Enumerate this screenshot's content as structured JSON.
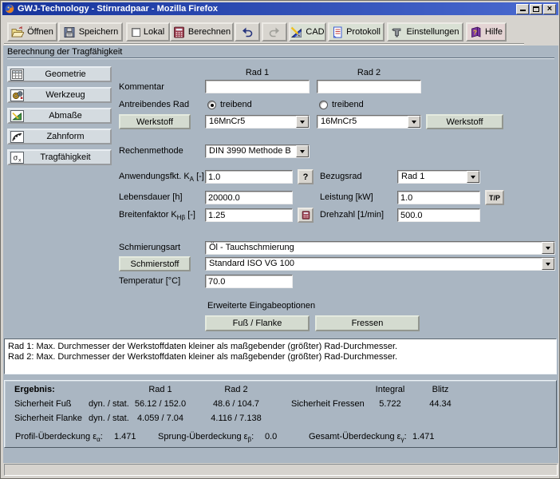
{
  "colors": {
    "titlebar_blue_left": "#16339b",
    "titlebar_blue_right": "#4a6ad0",
    "toolbar_bg": "#d6d3ce",
    "content_bg": "#aab6c2",
    "button_face": "#d8d5cf",
    "green_button_face": "#d4dbd0",
    "sidebar_button_face": "#d4dbe0",
    "hilfe_button_face": "#e4d4d4",
    "field_bg": "#ffffff"
  },
  "window": {
    "title": "GWJ-Technology - Stirnradpaar - Mozilla Firefox",
    "icons": [
      "firefox-icon",
      "minimize-icon",
      "maximize-icon",
      "close-icon"
    ]
  },
  "toolbar": {
    "oeffnen": "Öffnen",
    "speichern": "Speichern",
    "lokal": "Lokal",
    "lokal_checked": false,
    "berechnen": "Berechnen",
    "cad": "CAD",
    "protokoll": "Protokoll",
    "einstellungen": "Einstellungen",
    "hilfe": "Hilfe"
  },
  "page": {
    "header": "Berechnung der Tragfähigkeit"
  },
  "sidebar": {
    "items": [
      {
        "label": "Geometrie",
        "icon": "grid-icon"
      },
      {
        "label": "Werkzeug",
        "icon": "gears-icon"
      },
      {
        "label": "Abmaße",
        "icon": "tolerance-icon"
      },
      {
        "label": "Zahnform",
        "icon": "tooth-profile-icon"
      },
      {
        "label": "Tragfähigkeit",
        "icon": "sigma-icon"
      }
    ]
  },
  "form": {
    "col1_header": "Rad 1",
    "col2_header": "Rad 2",
    "kommentar": {
      "label": "Kommentar",
      "rad1_value": "",
      "rad2_value": ""
    },
    "antreibendes_rad": {
      "label": "Antreibendes Rad",
      "rad1_option": "treibend",
      "rad1_selected": true,
      "rad2_option": "treibend",
      "rad2_selected": false
    },
    "werkstoff": {
      "button_label": "Werkstoff",
      "rad1_value": "16MnCr5",
      "rad2_value": "16MnCr5"
    },
    "rechenmethode": {
      "label": "Rechenmethode",
      "value": "DIN 3990 Methode B"
    },
    "anwendungsfaktor": {
      "label_pre": "Anwendungsfkt. K",
      "label_sub": "A",
      "label_post": " [-]",
      "value": "1.0",
      "help_button": "?"
    },
    "lebensdauer": {
      "label": "Lebensdauer [h]",
      "value": "20000.0"
    },
    "breitenfaktor": {
      "label_pre": "Breitenfaktor K",
      "label_sub": "Hβ",
      "label_post": " [-]",
      "value": "1.25"
    },
    "bezugsrad": {
      "label": "Bezugsrad",
      "value": "Rad 1"
    },
    "leistung": {
      "label": "Leistung [kW]",
      "value": "1.0",
      "tp_button": "T/P"
    },
    "drehzahl": {
      "label": "Drehzahl [1/min]",
      "value": "500.0"
    },
    "schmierungsart": {
      "label": "Schmierungsart",
      "value": "Öl - Tauchschmierung"
    },
    "schmierstoff": {
      "button_label": "Schmierstoff",
      "value": "Standard ISO VG 100"
    },
    "temperatur": {
      "label": "Temperatur [°C]",
      "value": "70.0"
    },
    "erweiterte": {
      "label": "Erweiterte Eingabeoptionen",
      "fuss_flanke_button": "Fuß / Flanke",
      "fressen_button": "Fressen"
    }
  },
  "messages": {
    "lines": [
      "Rad 1: Max. Durchmesser der Werkstoffdaten kleiner als maßgebender (größter) Rad-Durchmesser.",
      "Rad 2: Max. Durchmesser der Werkstoffdaten kleiner als maßgebender (größter) Rad-Durchmesser."
    ]
  },
  "results": {
    "title": "Ergebnis:",
    "col_rad1": "Rad 1",
    "col_rad2": "Rad 2",
    "col_integral": "Integral",
    "col_blitz": "Blitz",
    "fuss": {
      "label": "Sicherheit Fuß",
      "mode": "dyn. / stat.",
      "rad1": "56.12 / 152.0",
      "rad2": "48.6 / 104.7"
    },
    "flanke": {
      "label": "Sicherheit Flanke",
      "mode": "dyn. / stat.",
      "rad1": "4.059 / 7.04",
      "rad2": "4.116 / 7.138"
    },
    "fressen": {
      "label": "Sicherheit Fressen",
      "integral": "5.722",
      "blitz": "44.34"
    },
    "ueberdeckung": {
      "profil_pre": "Profil-Überdeckung ε",
      "profil_sub": "α",
      "profil_colon": ":",
      "profil_value": "1.471",
      "sprung_pre": "Sprung-Überdeckung ε",
      "sprung_sub": "β",
      "sprung_colon": ":",
      "sprung_value": "0.0",
      "gesamt_pre": "Gesamt-Überdeckung ε",
      "gesamt_sub": "γ",
      "gesamt_colon": ":",
      "gesamt_value": "1.471"
    }
  }
}
